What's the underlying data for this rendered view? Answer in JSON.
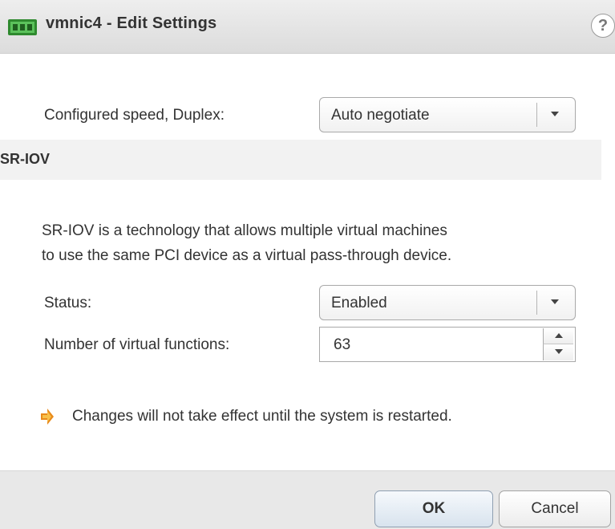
{
  "dialog": {
    "title": "vmnic4 - Edit Settings",
    "help_glyph": "?",
    "icon": "network-card-icon"
  },
  "speed": {
    "label": "Configured speed, Duplex:",
    "value": "Auto negotiate"
  },
  "sriov": {
    "section_title": "SR-IOV",
    "description_line1": "SR-IOV is a technology that allows multiple virtual machines",
    "description_line2": "to use the same PCI device as a virtual pass-through device.",
    "status_label": "Status:",
    "status_value": "Enabled",
    "vf_label": "Number of virtual functions:",
    "vf_value": "63"
  },
  "warning": {
    "icon": "warning-icon",
    "text": "Changes will not take effect until the system is restarted."
  },
  "buttons": {
    "ok": "OK",
    "cancel": "Cancel"
  },
  "colors": {
    "titlebar": "#dcdcdc",
    "section_header": "#f2f2f2",
    "footer": "#e8e8e8",
    "nic_icon_green": "#3a9c3a",
    "warning_orange": "#e88a1a"
  }
}
